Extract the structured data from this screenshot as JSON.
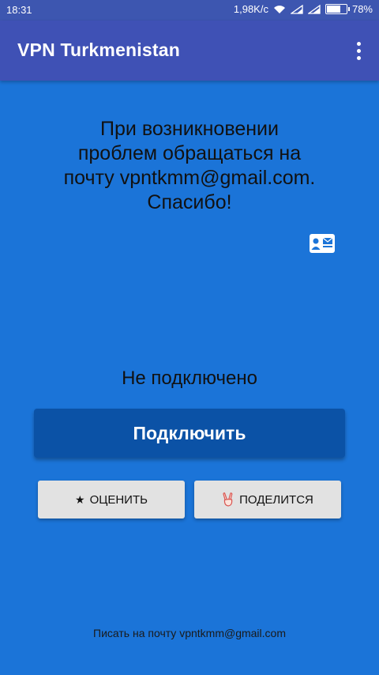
{
  "status_bar": {
    "time": "18:31",
    "network_speed": "1,98K/c",
    "battery_percent": "78%",
    "battery_level": 0.78
  },
  "app_bar": {
    "title": "VPN Turkmenistan",
    "menu_icon": "more-vert-icon"
  },
  "main": {
    "message_lines": [
      "При возникновении",
      "проблем обращаться на",
      "почту vpntkmm@gmail.com.",
      "Спасибо!"
    ],
    "contact_icon": "contact-mail-icon",
    "connection_status": "Не подключено",
    "connect_label": "Подключить"
  },
  "actions": {
    "rate_icon": "★",
    "rate_label": "ОЦЕНИТЬ",
    "share_icon": "victory-hand-icon",
    "share_label": "ПОДЕЛИТСЯ"
  },
  "footer": {
    "email_link": "Писать на почту vpntkmm@gmail.com"
  },
  "colors": {
    "background": "#1B74D8",
    "app_bar": "#3F51B5",
    "status_bar": "#3D56B0",
    "connect_button": "#0B52A6",
    "secondary_button": "#E2E2E2"
  }
}
